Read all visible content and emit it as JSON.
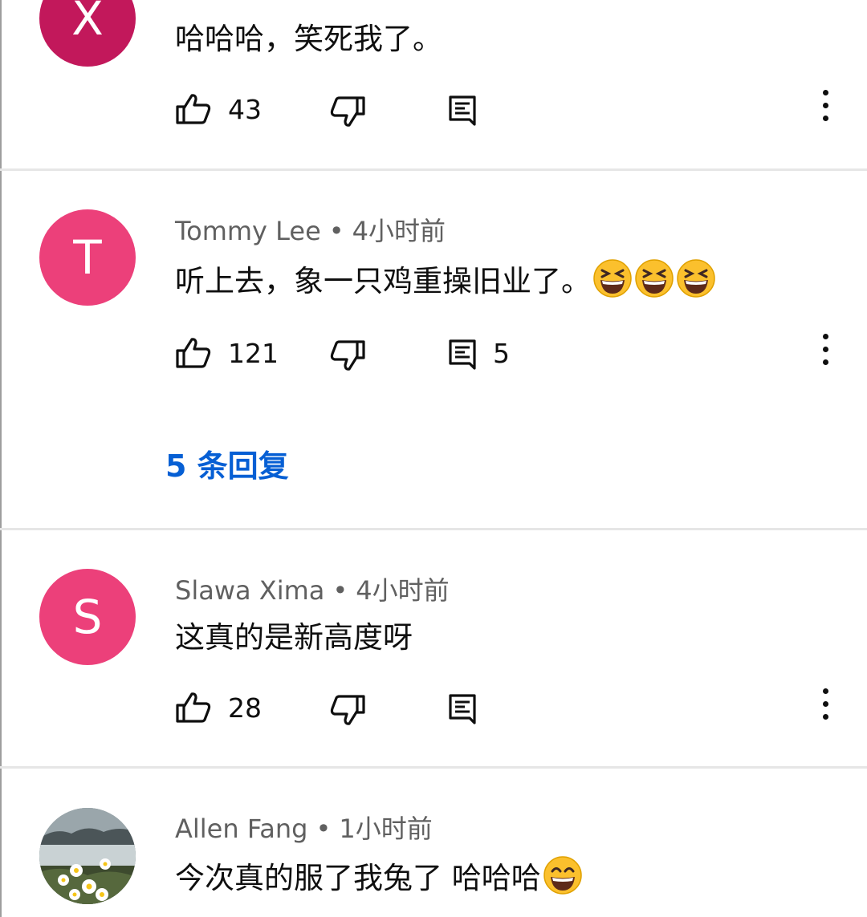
{
  "comments": [
    {
      "avatar_letter": "X",
      "avatar_color": "#c2185b",
      "author": "",
      "time": "",
      "text": "哈哈哈，笑死我了。",
      "likes": "43",
      "reply_count": ""
    },
    {
      "avatar_letter": "T",
      "avatar_color": "#ec407a",
      "author": "Tommy Lee",
      "time": "4小时前",
      "text": "听上去，象一只鸡重操旧业了。",
      "emojis": [
        "grinning-squinting-face",
        "grinning-squinting-face",
        "grinning-squinting-face"
      ],
      "likes": "121",
      "reply_count": "5",
      "replies_link": "5 条回复"
    },
    {
      "avatar_letter": "S",
      "avatar_color": "#ec407a",
      "author": "Slawa Xima",
      "time": "4小时前",
      "text": "这真的是新高度呀",
      "likes": "28",
      "reply_count": ""
    },
    {
      "avatar_letter": "",
      "avatar_color": "#6b7a7c",
      "author": "Allen Fang",
      "time": "1小时前",
      "text": "今次真的服了我兔了 哈哈哈",
      "emojis": [
        "grinning-face-with-smiling-eyes"
      ],
      "likes": "",
      "reply_count": ""
    }
  ],
  "separator": "•",
  "colors": {
    "link": "#065fd4",
    "meta": "#606060",
    "divider": "#e6e6e6"
  }
}
